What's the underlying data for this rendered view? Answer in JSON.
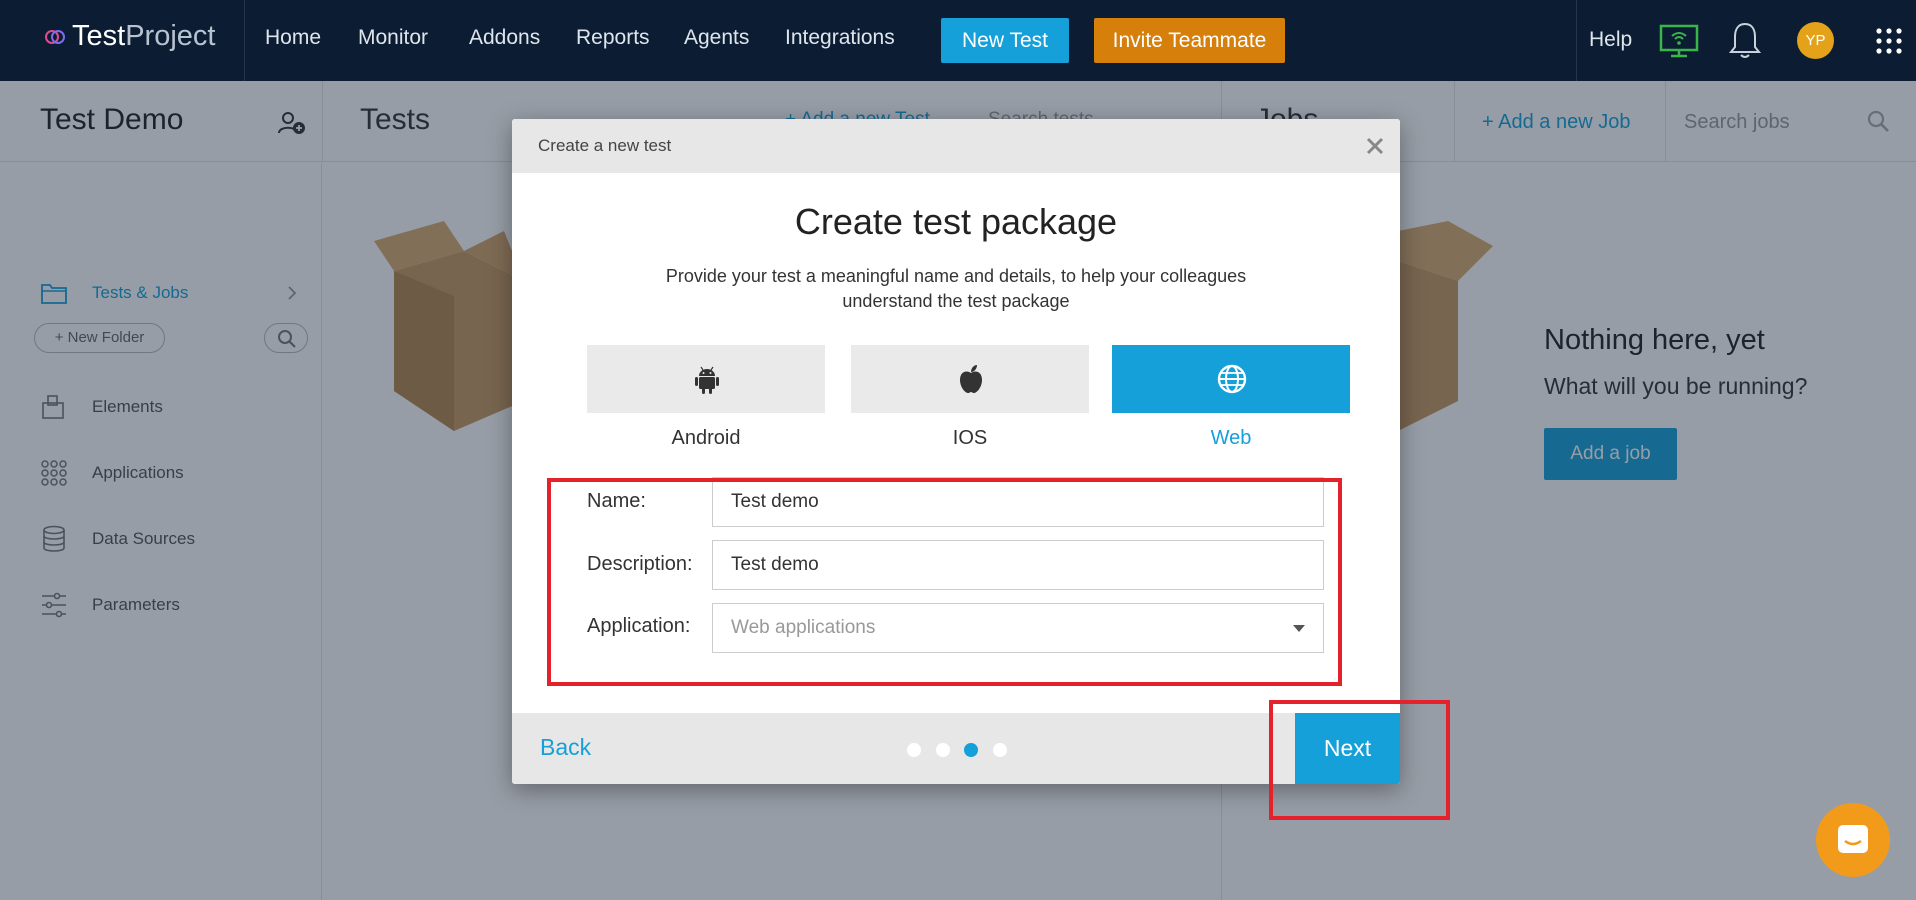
{
  "topbar": {
    "logo": {
      "part1": "Test",
      "part2": "Project"
    },
    "nav": [
      "Home",
      "Monitor",
      "Addons",
      "Reports",
      "Agents",
      "Integrations"
    ],
    "new_test": "New Test",
    "invite": "Invite Teammate",
    "help": "Help",
    "avatar": "YP"
  },
  "subheader": {
    "project_title": "Test Demo",
    "tests_title": "Tests",
    "add_test_peek": "+ Add a new Test",
    "search_tests_peek": "Search tests",
    "jobs_peek": "Jobs",
    "add_job": "+  Add a new Job",
    "search_jobs": "Search jobs"
  },
  "sidebar": {
    "items": [
      {
        "label": "Tests & Jobs",
        "icon": "folder-icon"
      },
      {
        "label": "Elements",
        "icon": "elements-icon"
      },
      {
        "label": "Applications",
        "icon": "apps-grid-icon"
      },
      {
        "label": "Data Sources",
        "icon": "database-icon"
      },
      {
        "label": "Parameters",
        "icon": "sliders-icon"
      }
    ],
    "new_folder": "+ New Folder"
  },
  "jobs_pane": {
    "heading": "Nothing here, yet",
    "subheading": "What will you be running?",
    "button": "Add a job"
  },
  "modal": {
    "header": "Create a new test",
    "title": "Create test package",
    "subtitle": "Provide your test a meaningful name and details, to help your colleagues understand the test package",
    "platforms": [
      {
        "label": "Android",
        "icon": "android-icon",
        "selected": false
      },
      {
        "label": "IOS",
        "icon": "apple-icon",
        "selected": false
      },
      {
        "label": "Web",
        "icon": "globe-icon",
        "selected": true
      }
    ],
    "fields": {
      "name_label": "Name:",
      "name_value": "Test demo",
      "description_label": "Description:",
      "description_value": "Test demo",
      "application_label": "Application:",
      "application_placeholder": "Web applications"
    },
    "footer": {
      "back": "Back",
      "next": "Next",
      "steps_total": 4,
      "current_step": 3
    }
  },
  "colors": {
    "navbar": "#0c1d33",
    "accent": "#15a0d9",
    "invite": "#d67f0b",
    "highlight": "#e3222b",
    "chat": "#f29b1b"
  }
}
